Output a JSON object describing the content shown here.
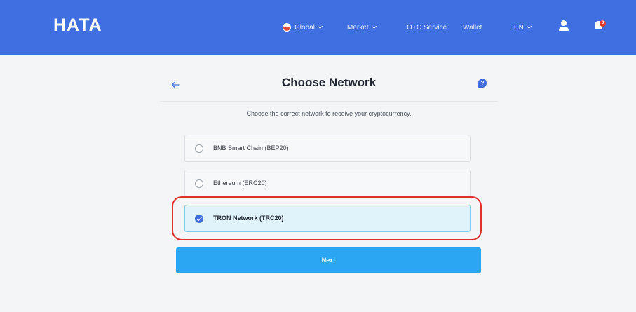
{
  "header": {
    "logo": "HATA",
    "nav": [
      {
        "id": "global",
        "label": "Global",
        "has_caret": true
      },
      {
        "id": "market",
        "label": "Market",
        "has_caret": true
      },
      {
        "id": "otc",
        "label": "OTC Service",
        "has_caret": false
      },
      {
        "id": "wallet",
        "label": "Wallet",
        "has_caret": false
      },
      {
        "id": "lang",
        "label": "EN",
        "has_caret": true
      }
    ],
    "notification_count": "3"
  },
  "page": {
    "title": "Choose Network",
    "help_glyph": "?",
    "subtitle": "Choose the correct network to receive your cryptocurrency.",
    "options": [
      {
        "label": "BNB Smart Chain (BEP20)",
        "selected": false
      },
      {
        "label": "Ethereum (ERC20)",
        "selected": false
      },
      {
        "label": "TRON Network (TRC20)",
        "selected": true
      }
    ],
    "next_label": "Next"
  },
  "colors": {
    "header_bg": "#3f6fe0",
    "button_bg": "#2aa6f2",
    "selected_bg": "#e0f3fb",
    "highlight": "#e0322d"
  }
}
